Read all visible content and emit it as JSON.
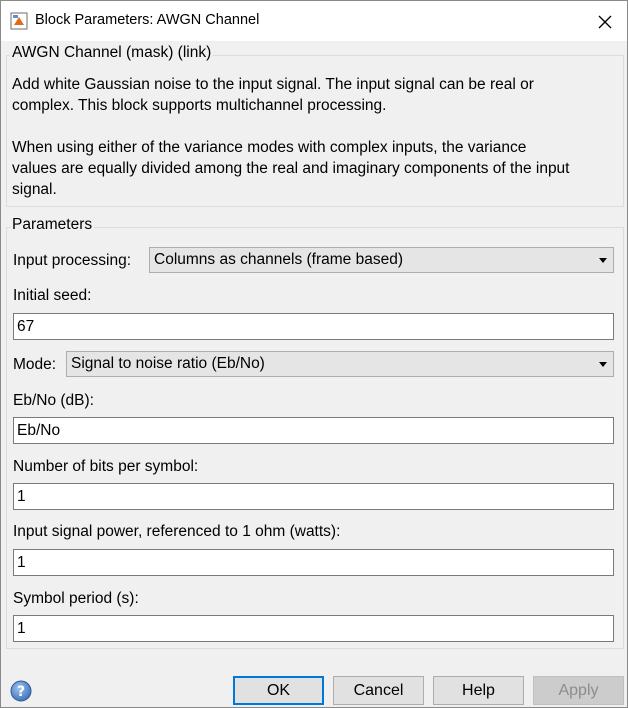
{
  "window": {
    "title": "Block Parameters: AWGN Channel",
    "close_icon": "close-icon",
    "app_icon": "simulink-block-icon"
  },
  "description_group": {
    "legend": "AWGN Channel (mask) (link)",
    "line1": "Add white Gaussian noise to the input signal. The input signal can be real or",
    "line2": "complex. This block supports multichannel processing.",
    "line3": "When using either of the variance modes with complex inputs, the variance",
    "line4": "values are equally divided among the real and imaginary components of the input",
    "line5": "signal."
  },
  "parameters_group": {
    "legend": "Parameters",
    "input_processing": {
      "label": "Input processing:",
      "value": "Columns as channels (frame based)"
    },
    "initial_seed": {
      "label": "Initial seed:",
      "value": "67"
    },
    "mode": {
      "label": "Mode:",
      "value": "Signal to noise ratio  (Eb/No)"
    },
    "ebno": {
      "label": "Eb/No (dB):",
      "value": "Eb/No"
    },
    "bits_per_symbol": {
      "label": "Number of bits per symbol:",
      "value": "1"
    },
    "signal_power": {
      "label": "Input signal power, referenced to 1 ohm (watts):",
      "value": "1"
    },
    "symbol_period": {
      "label": "Symbol period (s):",
      "value": "1"
    }
  },
  "buttons": {
    "ok": "OK",
    "cancel": "Cancel",
    "help": "Help",
    "apply": "Apply",
    "help_icon": "question-mark-icon"
  },
  "colors": {
    "default_button_border": "#0078d7",
    "window_bg": "#f0f0f0",
    "help_icon_blue": "#3b6fb6"
  }
}
